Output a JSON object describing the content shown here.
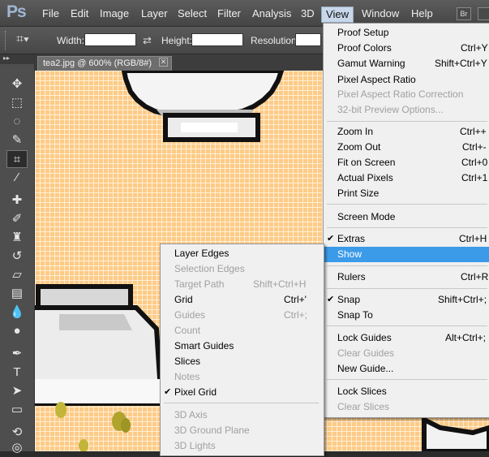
{
  "app": {
    "logo": "Ps"
  },
  "menubar": {
    "items": [
      "File",
      "Edit",
      "Image",
      "Layer",
      "Select",
      "Filter",
      "Analysis",
      "3D",
      "View",
      "Window",
      "Help"
    ],
    "bridge": "Br"
  },
  "options": {
    "width_label": "Width:",
    "height_label": "Height:",
    "resolution_label": "Resolution:"
  },
  "document": {
    "tab_title": "tea2.jpg @ 600% (RGB/8#)",
    "close": "✕"
  },
  "view_menu": {
    "items": [
      {
        "label": "Proof Setup",
        "shortcut": "",
        "disabled": false
      },
      {
        "label": "Proof Colors",
        "shortcut": "Ctrl+Y",
        "disabled": false
      },
      {
        "label": "Gamut Warning",
        "shortcut": "Shift+Ctrl+Y",
        "disabled": false
      },
      {
        "label": "Pixel Aspect Ratio",
        "shortcut": "",
        "disabled": false
      },
      {
        "label": "Pixel Aspect Ratio Correction",
        "shortcut": "",
        "disabled": true
      },
      {
        "label": "32-bit Preview Options...",
        "shortcut": "",
        "disabled": true
      },
      {
        "label": "Zoom In",
        "shortcut": "Ctrl++",
        "disabled": false
      },
      {
        "label": "Zoom Out",
        "shortcut": "Ctrl+-",
        "disabled": false
      },
      {
        "label": "Fit on Screen",
        "shortcut": "Ctrl+0",
        "disabled": false
      },
      {
        "label": "Actual Pixels",
        "shortcut": "Ctrl+1",
        "disabled": false
      },
      {
        "label": "Print Size",
        "shortcut": "",
        "disabled": false
      },
      {
        "label": "Screen Mode",
        "shortcut": "",
        "disabled": false
      },
      {
        "label": "Extras",
        "shortcut": "Ctrl+H",
        "disabled": false,
        "checked": true
      },
      {
        "label": "Show",
        "shortcut": "",
        "disabled": false,
        "highlighted": true
      },
      {
        "label": "Rulers",
        "shortcut": "Ctrl+R",
        "disabled": false
      },
      {
        "label": "Snap",
        "shortcut": "Shift+Ctrl+;",
        "disabled": false,
        "checked": true
      },
      {
        "label": "Snap To",
        "shortcut": "",
        "disabled": false
      },
      {
        "label": "Lock Guides",
        "shortcut": "Alt+Ctrl+;",
        "disabled": false
      },
      {
        "label": "Clear Guides",
        "shortcut": "",
        "disabled": true
      },
      {
        "label": "New Guide...",
        "shortcut": "",
        "disabled": false
      },
      {
        "label": "Lock Slices",
        "shortcut": "",
        "disabled": false
      },
      {
        "label": "Clear Slices",
        "shortcut": "",
        "disabled": true
      }
    ]
  },
  "show_menu": {
    "items": [
      {
        "label": "Layer Edges",
        "shortcut": "",
        "disabled": false
      },
      {
        "label": "Selection Edges",
        "shortcut": "",
        "disabled": true
      },
      {
        "label": "Target Path",
        "shortcut": "Shift+Ctrl+H",
        "disabled": true
      },
      {
        "label": "Grid",
        "shortcut": "Ctrl+'",
        "disabled": false
      },
      {
        "label": "Guides",
        "shortcut": "Ctrl+;",
        "disabled": true
      },
      {
        "label": "Count",
        "shortcut": "",
        "disabled": true
      },
      {
        "label": "Smart Guides",
        "shortcut": "",
        "disabled": false
      },
      {
        "label": "Slices",
        "shortcut": "",
        "disabled": false
      },
      {
        "label": "Notes",
        "shortcut": "",
        "disabled": true
      },
      {
        "label": "Pixel Grid",
        "shortcut": "",
        "disabled": false,
        "checked": true
      },
      {
        "label": "3D Axis",
        "shortcut": "",
        "disabled": true
      },
      {
        "label": "3D Ground Plane",
        "shortcut": "",
        "disabled": true
      },
      {
        "label": "3D Lights",
        "shortcut": "",
        "disabled": true
      }
    ]
  },
  "colors": {
    "highlight": "#3c9be8",
    "canvas": "#fdcb87"
  }
}
